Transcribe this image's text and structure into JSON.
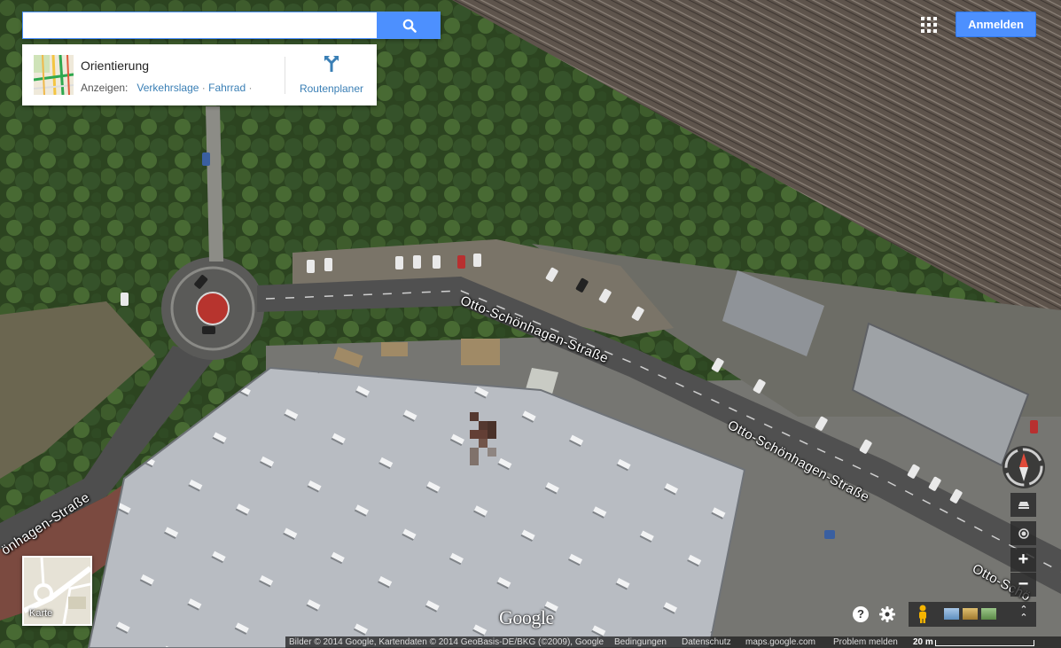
{
  "search": {
    "placeholder": "",
    "value": "",
    "button_icon": "search-icon"
  },
  "card": {
    "title": "Orientierung",
    "show_label": "Anzeigen:",
    "links": [
      "Verkehrslage",
      "Fahrrad"
    ],
    "separator": "·",
    "route_label": "Routenplaner",
    "route_icon": "directions-icon"
  },
  "header": {
    "apps_icon": "apps-grid-icon",
    "signin_label": "Anmelden"
  },
  "map": {
    "streets": [
      "Otto-Schönhagen-Straße",
      "Otto-Schönhagen-Straße",
      "Otto-Schö",
      "önhagen-Straße"
    ],
    "logo": "Google"
  },
  "controls": {
    "compass_icon": "compass-icon",
    "tilt_icon": "tilt-icon",
    "location_icon": "my-location-icon",
    "zoom_in_label": "+",
    "zoom_out_label": "−"
  },
  "map_toggle": {
    "label": "Karte"
  },
  "bottom": {
    "help_label": "?",
    "settings_icon": "gear-icon",
    "pegman_icon": "pegman-icon",
    "expand_icon": "expand-icon"
  },
  "footer": {
    "imagery": "Bilder © 2014 Google, Kartendaten © 2014 GeoBasis-DE/BKG (©2009), Google",
    "terms": "Bedingungen",
    "privacy": "Datenschutz",
    "site": "maps.google.com",
    "report": "Problem melden",
    "scale": "20 m"
  },
  "colors": {
    "accent": "#4d90fe",
    "link": "#3a7fb5"
  }
}
